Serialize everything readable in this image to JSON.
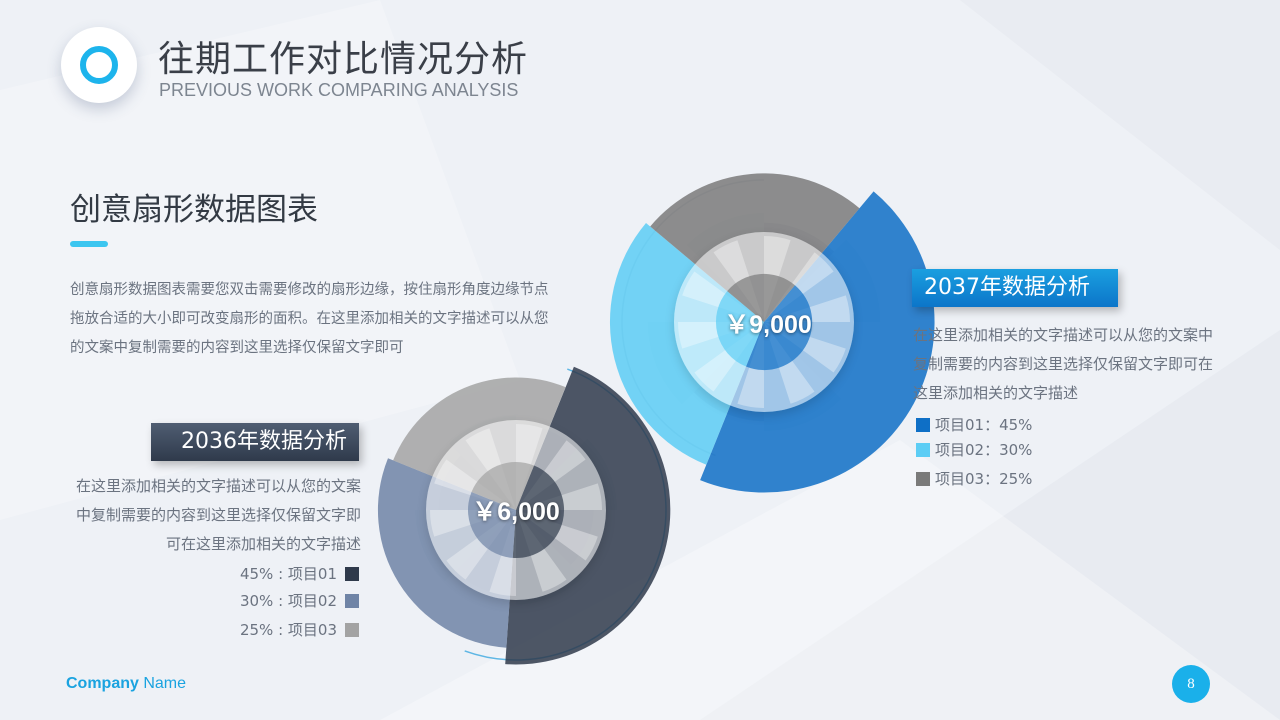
{
  "header": {
    "title_cn": "往期工作对比情况分析",
    "title_en": "PREVIOUS WORK COMPARING ANALYSIS"
  },
  "section": {
    "title": "创意扇形数据图表",
    "intro": "创意扇形数据图表需要您双击需要修改的扇形边缘，按住扇形角度边缘节点拖放合适的大小即可改变扇形的面积。在这里添加相关的文字描述可以从您的文案中复制需要的内容到这里选择仅保留文字即可"
  },
  "colors": {
    "accent": "#3cc6f0",
    "dark_1": "#2f3a4b",
    "dark_2": "#6f84a6",
    "dark_3": "#a3a3a3",
    "blue_1": "#0e6fc6",
    "blue_2": "#5ccdf5",
    "blue_3": "#7a7a7a"
  },
  "chart_data": [
    {
      "type": "pie",
      "title": "2036年数据分析",
      "center_label": "￥6,000",
      "categories": [
        "项目01",
        "项目02",
        "项目03"
      ],
      "values": [
        45,
        30,
        25
      ],
      "legend": [
        "45% : 项目01",
        "30% : 项目02",
        "25% : 项目03"
      ],
      "description": "在这里添加相关的文字描述可以从您的文案中复制需要的内容到这里选择仅保留文字即可在这里添加相关的文字描述"
    },
    {
      "type": "pie",
      "title": "2037年数据分析",
      "center_label": "￥9,000",
      "categories": [
        "项目01",
        "项目02",
        "项目03"
      ],
      "values": [
        45,
        30,
        25
      ],
      "legend": [
        "项目01：45%",
        "项目02：30%",
        "项目03：25%"
      ],
      "description": "在这里添加相关的文字描述可以从您的文案中复制需要的内容到这里选择仅保留文字即可在这里添加相关的文字描述"
    }
  ],
  "footer": {
    "company_bold": "Company",
    "company_rest": " Name",
    "page_number": "8"
  }
}
